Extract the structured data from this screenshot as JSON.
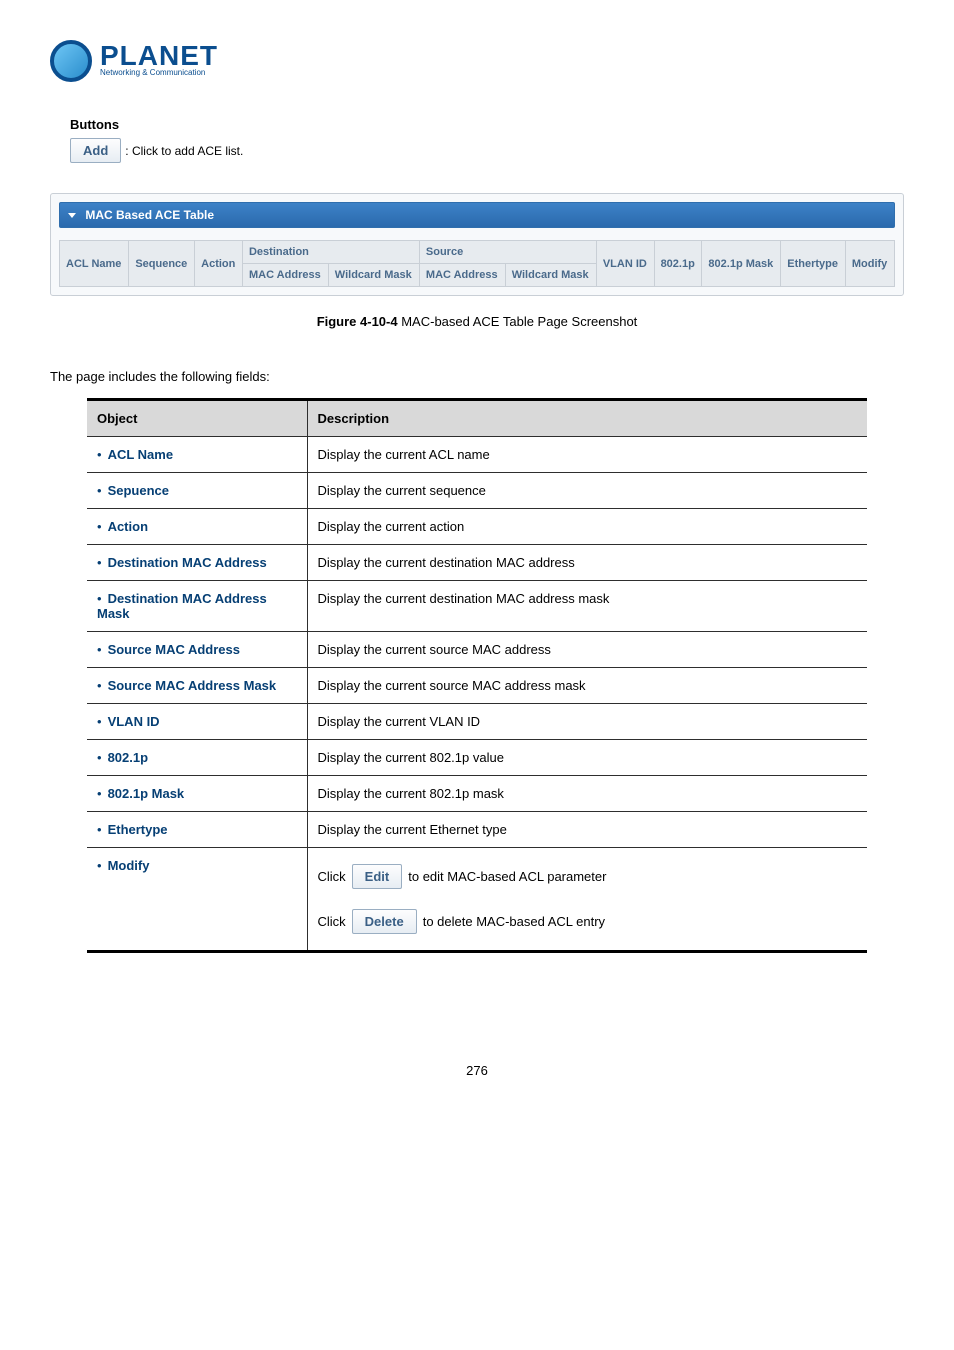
{
  "logo": {
    "name": "PLANET",
    "tag": "Networking & Communication"
  },
  "buttons": {
    "heading": "Buttons",
    "add_label": "Add",
    "add_text": ": Click to add ACE list."
  },
  "panel": {
    "title": "MAC Based ACE Table",
    "headers": {
      "acl_name": "ACL Name",
      "sequence": "Sequence",
      "action": "Action",
      "destination": "Destination",
      "dest_mac": "MAC Address",
      "dest_mask": "Wildcard Mask",
      "source": "Source",
      "src_mac": "MAC Address",
      "src_mask": "Wildcard Mask",
      "vlan_id": "VLAN ID",
      "8021p": "802.1p",
      "8021p_mask": "802.1p Mask",
      "ethertype": "Ethertype",
      "modify": "Modify"
    }
  },
  "figure": {
    "num": "Figure 4-10-4",
    "caption": " MAC-based ACE Table Page Screenshot"
  },
  "intro": "The page includes the following fields:",
  "table": {
    "head_object": "Object",
    "head_description": "Description",
    "rows": [
      {
        "label": "ACL Name",
        "desc": "Display the current ACL name"
      },
      {
        "label": "Sepuence",
        "desc": "Display the current sequence"
      },
      {
        "label": "Action",
        "desc": "Display the current action"
      },
      {
        "label": "Destination MAC Address",
        "desc": "Display the current destination MAC address"
      },
      {
        "label": "Destination MAC Address Mask",
        "desc": "Display the current destination MAC address mask"
      },
      {
        "label": "Source MAC Address",
        "desc": "Display the current source MAC address"
      },
      {
        "label": "Source MAC Address Mask",
        "desc": "Display the current source MAC address mask"
      },
      {
        "label": "VLAN ID",
        "desc": "Display the current VLAN ID"
      },
      {
        "label": "802.1p",
        "desc": "Display the current 802.1p value"
      },
      {
        "label": "802.1p Mask",
        "desc": "Display the current 802.1p mask"
      },
      {
        "label": "Ethertype",
        "desc": "Display the current Ethernet type"
      }
    ],
    "modify": {
      "label": "Modify",
      "click": "Click",
      "edit_btn": "Edit",
      "edit_text": " to edit MAC-based ACL parameter",
      "delete_btn": "Delete",
      "delete_text": " to delete MAC-based ACL entry"
    }
  },
  "page_number": "276"
}
